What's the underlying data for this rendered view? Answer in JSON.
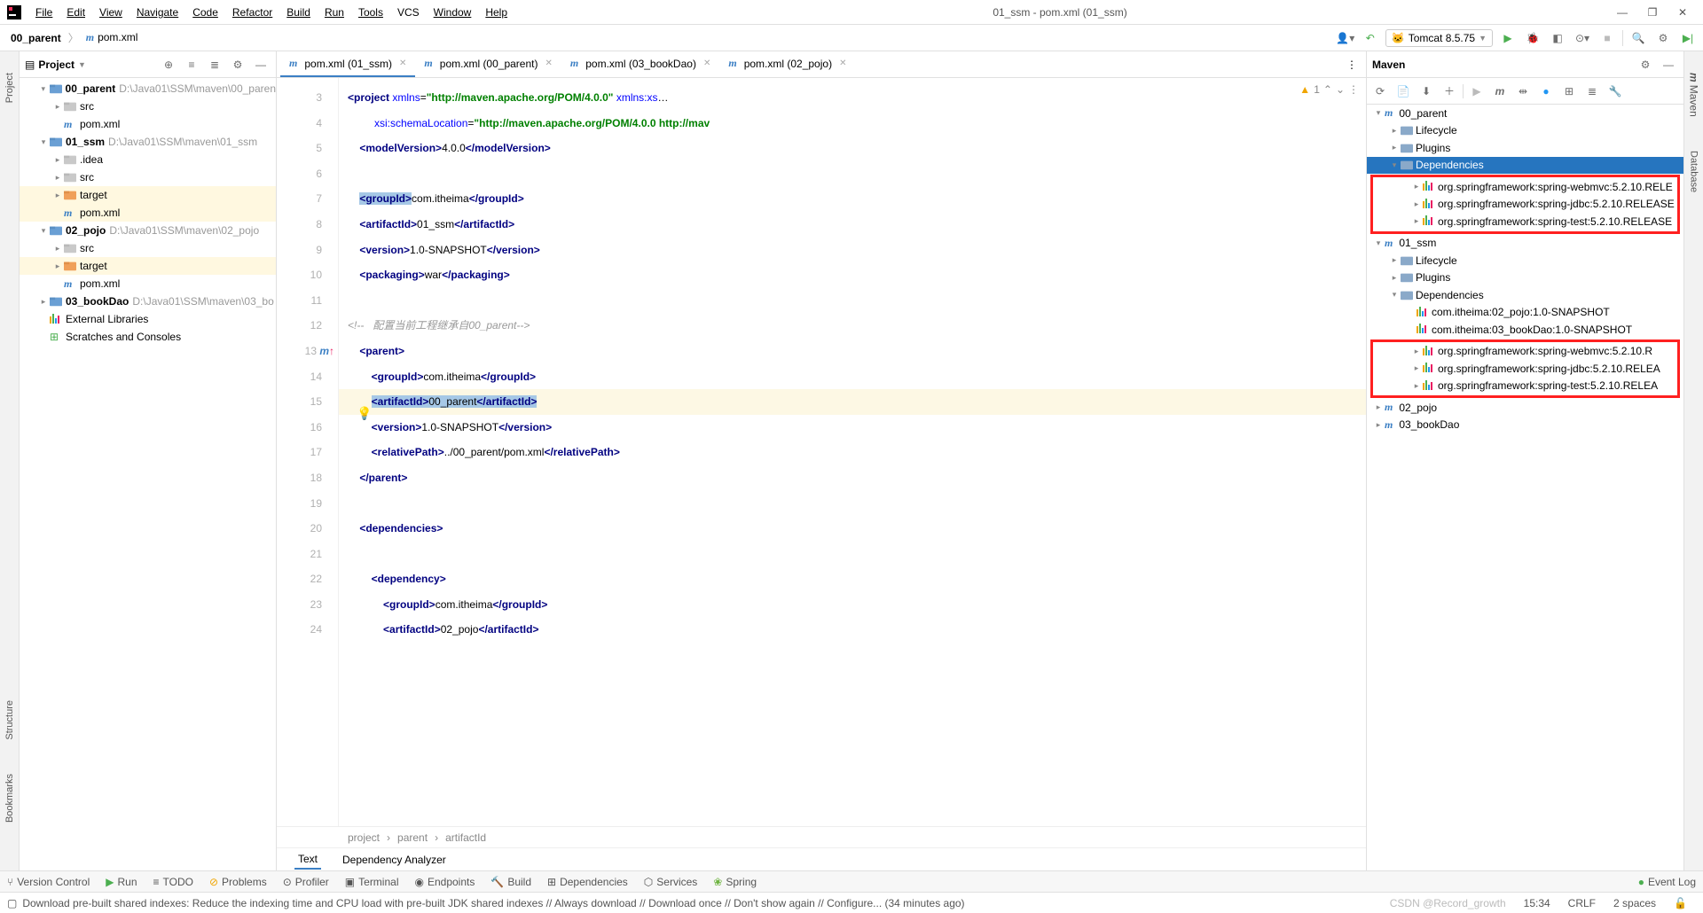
{
  "window": {
    "title": "01_ssm - pom.xml (01_ssm)"
  },
  "menu": {
    "file": "File",
    "edit": "Edit",
    "view": "View",
    "navigate": "Navigate",
    "code": "Code",
    "refactor": "Refactor",
    "build": "Build",
    "run": "Run",
    "tools": "Tools",
    "vcs": "VCS",
    "window": "Window",
    "help": "Help"
  },
  "breadcrumb": {
    "root": "00_parent",
    "file": "pom.xml"
  },
  "run_config": {
    "label": "Tomcat 8.5.75"
  },
  "project_panel": {
    "title": "Project",
    "tree": [
      {
        "d": 1,
        "exp": "open",
        "icon": "mod",
        "name": "00_parent",
        "path": "D:\\Java01\\SSM\\maven\\00_paren"
      },
      {
        "d": 2,
        "exp": "closed",
        "icon": "dir",
        "name": "src"
      },
      {
        "d": 2,
        "exp": "",
        "icon": "m",
        "name": "pom.xml"
      },
      {
        "d": 1,
        "exp": "open",
        "icon": "mod",
        "name": "01_ssm",
        "path": "D:\\Java01\\SSM\\maven\\01_ssm"
      },
      {
        "d": 2,
        "exp": "closed",
        "icon": "dir",
        "name": ".idea"
      },
      {
        "d": 2,
        "exp": "closed",
        "icon": "dir",
        "name": "src"
      },
      {
        "d": 2,
        "exp": "closed",
        "icon": "odir",
        "name": "target",
        "sel": true
      },
      {
        "d": 2,
        "exp": "",
        "icon": "m",
        "name": "pom.xml",
        "sel": true
      },
      {
        "d": 1,
        "exp": "open",
        "icon": "mod",
        "name": "02_pojo",
        "path": "D:\\Java01\\SSM\\maven\\02_pojo"
      },
      {
        "d": 2,
        "exp": "closed",
        "icon": "dir",
        "name": "src"
      },
      {
        "d": 2,
        "exp": "closed",
        "icon": "odir",
        "name": "target",
        "sel": true
      },
      {
        "d": 2,
        "exp": "",
        "icon": "m",
        "name": "pom.xml"
      },
      {
        "d": 1,
        "exp": "closed",
        "icon": "mod",
        "name": "03_bookDao",
        "path": "D:\\Java01\\SSM\\maven\\03_bo"
      },
      {
        "d": 1,
        "exp": "",
        "icon": "lib",
        "name": "External Libraries"
      },
      {
        "d": 1,
        "exp": "",
        "icon": "scr",
        "name": "Scratches and Consoles"
      }
    ]
  },
  "tabs": [
    {
      "label": "pom.xml (01_ssm)",
      "active": true
    },
    {
      "label": "pom.xml (00_parent)"
    },
    {
      "label": "pom.xml (03_bookDao)"
    },
    {
      "label": "pom.xml (02_pojo)"
    }
  ],
  "inspections": {
    "warn": "1",
    "weak": "^"
  },
  "code_lines": [
    {
      "n": 3,
      "html": "<span class='tag'>&lt;project</span> <span class='attr'>xmlns</span>=<span class='str'>\"http://maven.apache.org/POM/4.0.0\"</span> <span class='attr'>xmlns:xs</span><span class='txt'>…</span>"
    },
    {
      "n": 4,
      "html": "         <span class='attr'>xsi:schemaLocation</span>=<span class='str'>\"http://maven.apache.org/POM/4.0.0 http://mav</span>"
    },
    {
      "n": 5,
      "html": "    <span class='tag'>&lt;modelVersion&gt;</span>4.0.0<span class='tag'>&lt;/modelVersion&gt;</span>"
    },
    {
      "n": 6,
      "html": ""
    },
    {
      "n": 7,
      "html": "    <span class='tag sel-bg'>&lt;groupId&gt;</span>com.itheima<span class='tag'>&lt;/groupId&gt;</span>"
    },
    {
      "n": 8,
      "html": "    <span class='tag'>&lt;artifactId&gt;</span>01_ssm<span class='tag'>&lt;/artifactId&gt;</span>"
    },
    {
      "n": 9,
      "html": "    <span class='tag'>&lt;version&gt;</span>1.0-SNAPSHOT<span class='tag'>&lt;/version&gt;</span>"
    },
    {
      "n": 10,
      "html": "    <span class='tag'>&lt;packaging&gt;</span>war<span class='tag'>&lt;/packaging&gt;</span>"
    },
    {
      "n": 11,
      "html": ""
    },
    {
      "n": 12,
      "html": "<span class='cmt'>&lt;!--   配置当前工程继承自00_parent--&gt;</span>"
    },
    {
      "n": 13,
      "html": "    <span class='tag'>&lt;parent&gt;</span>",
      "marker": "m↑"
    },
    {
      "n": 14,
      "html": "        <span class='tag'>&lt;groupId&gt;</span>com.itheima<span class='tag'>&lt;/groupId&gt;</span>"
    },
    {
      "n": 15,
      "html": "        <span class='sel-bg'><span class='tag'>&lt;artifactId&gt;</span>00_parent<span class='tag'>&lt;/artifactId&gt;</span></span>",
      "hl": true
    },
    {
      "n": 16,
      "html": "        <span class='tag'>&lt;version&gt;</span>1.0-SNAPSHOT<span class='tag'>&lt;/version&gt;</span>"
    },
    {
      "n": 17,
      "html": "        <span class='tag'>&lt;relativePath&gt;</span>../00_parent/pom.xml<span class='tag'>&lt;/relativePath&gt;</span>"
    },
    {
      "n": 18,
      "html": "    <span class='tag'>&lt;/parent&gt;</span>"
    },
    {
      "n": 19,
      "html": ""
    },
    {
      "n": 20,
      "html": "    <span class='tag'>&lt;dependencies&gt;</span>"
    },
    {
      "n": 21,
      "html": ""
    },
    {
      "n": 22,
      "html": "        <span class='tag'>&lt;dependency&gt;</span>"
    },
    {
      "n": 23,
      "html": "            <span class='tag'>&lt;groupId&gt;</span>com.itheima<span class='tag'>&lt;/groupId&gt;</span>"
    },
    {
      "n": 24,
      "html": "            <span class='tag'>&lt;artifactId&gt;</span>02_pojo<span class='tag'>&lt;/artifactId&gt;</span>"
    }
  ],
  "editor_bread": [
    "project",
    "parent",
    "artifactId"
  ],
  "bottom_tabs": {
    "text": "Text",
    "dep": "Dependency Analyzer"
  },
  "maven": {
    "title": "Maven",
    "tree": [
      {
        "d": 0,
        "exp": "open",
        "icon": "m",
        "label": "00_parent"
      },
      {
        "d": 1,
        "exp": "closed",
        "icon": "folder",
        "label": "Lifecycle"
      },
      {
        "d": 1,
        "exp": "closed",
        "icon": "folder",
        "label": "Plugins"
      },
      {
        "d": 1,
        "exp": "open",
        "icon": "folder",
        "label": "Dependencies",
        "sel": true
      },
      {
        "red_group": [
          {
            "d": 2,
            "exp": "closed",
            "icon": "lib",
            "label": "org.springframework:spring-webmvc:5.2.10.RELE"
          },
          {
            "d": 2,
            "exp": "closed",
            "icon": "lib",
            "label": "org.springframework:spring-jdbc:5.2.10.RELEASE"
          },
          {
            "d": 2,
            "exp": "closed",
            "icon": "lib",
            "label": "org.springframework:spring-test:5.2.10.RELEASE"
          }
        ]
      },
      {
        "d": 0,
        "exp": "open",
        "icon": "m",
        "label": "01_ssm"
      },
      {
        "d": 1,
        "exp": "closed",
        "icon": "folder",
        "label": "Lifecycle"
      },
      {
        "d": 1,
        "exp": "closed",
        "icon": "folder",
        "label": "Plugins"
      },
      {
        "d": 1,
        "exp": "open",
        "icon": "folder",
        "label": "Dependencies"
      },
      {
        "d": 2,
        "exp": "",
        "icon": "lib",
        "label": "com.itheima:02_pojo:1.0-SNAPSHOT"
      },
      {
        "d": 2,
        "exp": "",
        "icon": "lib",
        "label": "com.itheima:03_bookDao:1.0-SNAPSHOT"
      },
      {
        "red_group": [
          {
            "d": 2,
            "exp": "closed",
            "icon": "lib",
            "label": "org.springframework:spring-webmvc:5.2.10.R"
          },
          {
            "d": 2,
            "exp": "closed",
            "icon": "lib",
            "label": "org.springframework:spring-jdbc:5.2.10.RELEA"
          },
          {
            "d": 2,
            "exp": "closed",
            "icon": "lib",
            "label": "org.springframework:spring-test:5.2.10.RELEA"
          }
        ]
      },
      {
        "d": 0,
        "exp": "closed",
        "icon": "m",
        "label": "02_pojo"
      },
      {
        "d": 0,
        "exp": "closed",
        "icon": "m",
        "label": "03_bookDao"
      }
    ]
  },
  "toolwindows": {
    "vc": "Version Control",
    "run": "Run",
    "todo": "TODO",
    "problems": "Problems",
    "profiler": "Profiler",
    "terminal": "Terminal",
    "endpoints": "Endpoints",
    "build": "Build",
    "dependencies": "Dependencies",
    "services": "Services",
    "spring": "Spring",
    "eventlog": "Event Log"
  },
  "status": {
    "msg": "Download pre-built shared indexes: Reduce the indexing time and CPU load with pre-built JDK shared indexes // Always download // Download once // Don't show again // Configure... (34 minutes ago)",
    "time": "15:34",
    "crlf": "CRLF",
    "spaces": "2 spaces",
    "watermark": "CSDN @Record_growth"
  },
  "left_rails": [
    "Project",
    "Structure",
    "Bookmarks"
  ],
  "right_rails": [
    "Maven",
    "Database"
  ]
}
